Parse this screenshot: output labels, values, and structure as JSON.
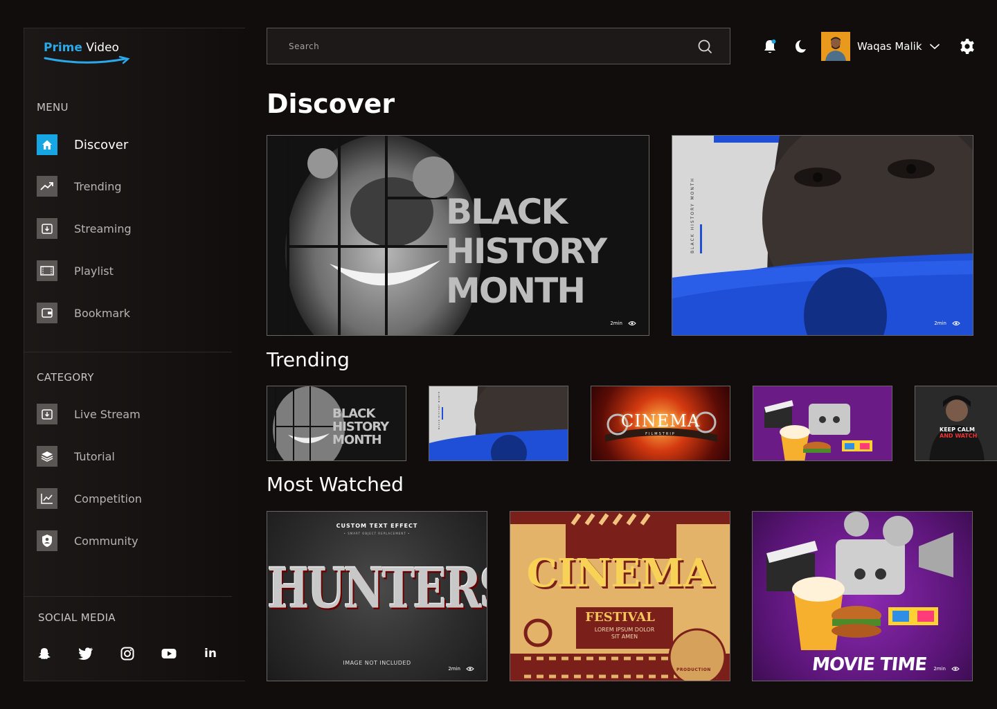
{
  "app": {
    "logo_prime": "Prime",
    "logo_video": "Video"
  },
  "sidebar": {
    "menu_label": "MENU",
    "menu": [
      {
        "label": "Discover",
        "icon": "home-icon",
        "active": true
      },
      {
        "label": "Trending",
        "icon": "trending-icon"
      },
      {
        "label": "Streaming",
        "icon": "streaming-icon"
      },
      {
        "label": "Playlist",
        "icon": "playlist-icon"
      },
      {
        "label": "Bookmark",
        "icon": "bookmark-icon"
      }
    ],
    "category_label": "CATEGORY",
    "categories": [
      {
        "label": "Live Stream",
        "icon": "live-stream-icon"
      },
      {
        "label": "Tutorial",
        "icon": "tutorial-icon"
      },
      {
        "label": "Competition",
        "icon": "competition-icon"
      },
      {
        "label": "Community",
        "icon": "community-icon"
      }
    ],
    "social_label": "SOCIAL MEDIA",
    "social": [
      "snapchat-icon",
      "twitter-icon",
      "instagram-icon",
      "youtube-icon",
      "linkedin-icon"
    ],
    "linkedin_text": "in"
  },
  "search": {
    "placeholder": "Search"
  },
  "user": {
    "name": "Waqas Malik"
  },
  "sections": {
    "discover": "Discover",
    "trending": "Trending",
    "most_watched": "Most Watched"
  },
  "discover_cards": [
    {
      "title_lines": [
        "BLACK",
        "HISTORY",
        "MONTH"
      ],
      "duration": "2min"
    },
    {
      "side_text": "BLACK HISTORY MONTH",
      "duration": "2min"
    }
  ],
  "trending_cards": [
    {
      "title_lines": [
        "BLACK",
        "HISTORY",
        "MONTH"
      ]
    },
    {
      "side_text": "BLACK HISTORY MONTH"
    },
    {
      "title": "CINEMA",
      "subtitle": "FILMSTRIP"
    },
    {
      "title": ""
    },
    {
      "title_lines": [
        "KEEP CALM",
        "AND WATCH"
      ]
    }
  ],
  "most_watched_cards": [
    {
      "top": "CUSTOM TEXT EFFECT",
      "top_sub": "• SMART OBJECT REPLACEMENT •",
      "title": "HUNTERS",
      "bottom": "IMAGE NOT INCLUDED",
      "duration": "2min"
    },
    {
      "title": "CINEMA",
      "subtitle": "FESTIVAL",
      "body": "LOREM IPSUM DOLOR SIT AMEN",
      "badge": "PRODUCTION"
    },
    {
      "title": "MOVIE TIME",
      "duration": "2min"
    }
  ],
  "colors": {
    "accent": "#17a6e4",
    "background": "#110d0c",
    "blue_paint": "#1f4fd6",
    "purple": "#6a1b86"
  }
}
